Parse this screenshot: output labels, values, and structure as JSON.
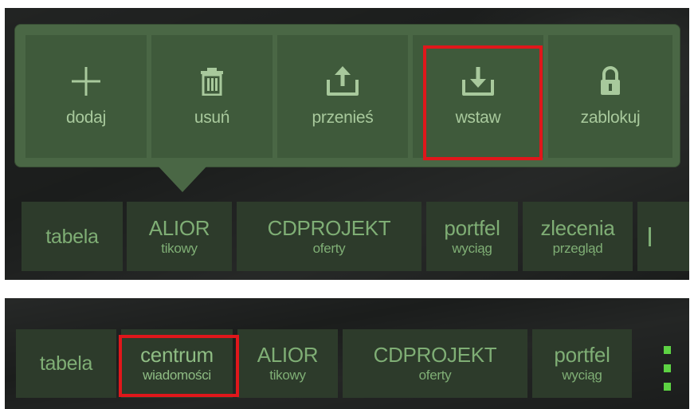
{
  "action_menu": {
    "items": [
      {
        "id": "add",
        "icon": "plus-icon",
        "label": "dodaj"
      },
      {
        "id": "delete",
        "icon": "trash-icon",
        "label": "usuń"
      },
      {
        "id": "move",
        "icon": "upload-icon",
        "label": "przenieś"
      },
      {
        "id": "paste",
        "icon": "download-icon",
        "label": "wstaw",
        "highlighted": true
      },
      {
        "id": "lock",
        "icon": "lock-icon",
        "label": "zablokuj"
      }
    ]
  },
  "tabs_top": [
    {
      "main": "tabela",
      "sub": ""
    },
    {
      "main": "ALIOR",
      "sub": "tikowy"
    },
    {
      "main": "CDPROJEKT",
      "sub": "oferty"
    },
    {
      "main": "portfel",
      "sub": "wyciąg"
    },
    {
      "main": "zlecenia",
      "sub": "przegląd"
    }
  ],
  "tabs_bottom": [
    {
      "main": "tabela",
      "sub": ""
    },
    {
      "main": "centrum",
      "sub": "wiadomości",
      "highlighted": true
    },
    {
      "main": "ALIOR",
      "sub": "tikowy"
    },
    {
      "main": "CDPROJEKT",
      "sub": "oferty"
    },
    {
      "main": "portfel",
      "sub": "wyciąg"
    }
  ],
  "colors": {
    "highlight": "#e0171b",
    "accent": "#5dd243",
    "text": "#7fae75"
  }
}
